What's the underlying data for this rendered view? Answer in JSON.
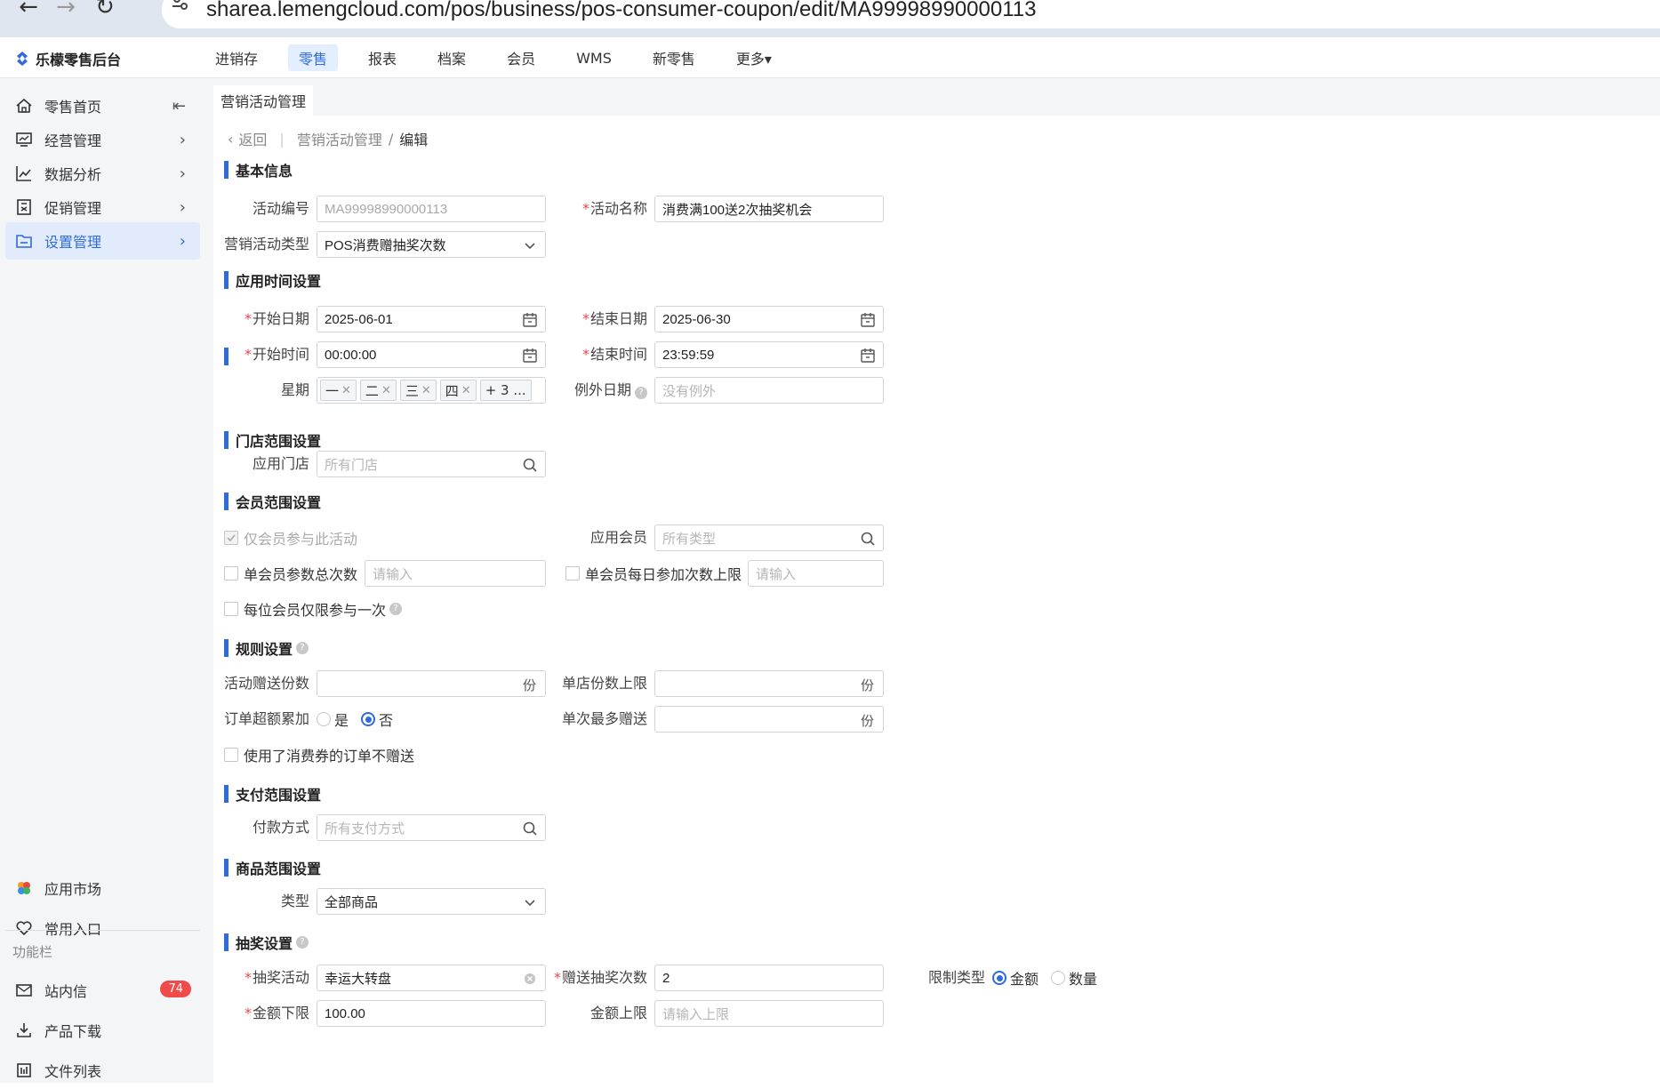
{
  "browser": {
    "url": "sharea.lemengcloud.com/pos/business/pos-consumer-coupon/edit/MA99998990000113"
  },
  "app": {
    "title": "乐檬零售后台"
  },
  "topmenu": [
    {
      "label": "进销存",
      "active": false
    },
    {
      "label": "零售",
      "active": true
    },
    {
      "label": "报表",
      "active": false
    },
    {
      "label": "档案",
      "active": false
    },
    {
      "label": "会员",
      "active": false
    },
    {
      "label": "WMS",
      "active": false
    },
    {
      "label": "新零售",
      "active": false
    },
    {
      "label": "更多▾",
      "active": false
    }
  ],
  "sidebar": {
    "items": [
      {
        "label": "零售首页",
        "icon": "home-icon"
      },
      {
        "label": "经营管理",
        "icon": "monitor-chart-icon"
      },
      {
        "label": "数据分析",
        "icon": "line-chart-icon"
      },
      {
        "label": "促销管理",
        "icon": "promotion-icon"
      },
      {
        "label": "设置管理",
        "icon": "folder-icon"
      }
    ],
    "bottom": [
      {
        "label": "应用市场",
        "icon": "app-market-icon"
      },
      {
        "label": "常用入口",
        "icon": "heart-icon"
      }
    ],
    "caption": "功能栏",
    "tools": [
      {
        "label": "站内信",
        "icon": "mail-icon",
        "badge": "74"
      },
      {
        "label": "产品下载",
        "icon": "download-icon"
      },
      {
        "label": "文件列表",
        "icon": "file-list-icon"
      }
    ]
  },
  "tab": {
    "label": "营销活动管理"
  },
  "breadcrumb": {
    "back": "返回",
    "parent": "营销活动管理",
    "sep": "/",
    "current": "编辑"
  },
  "sections": {
    "basic": "基本信息",
    "time": "应用时间设置",
    "store": "门店范围设置",
    "member": "会员范围设置",
    "rule": "规则设置",
    "pay": "支付范围设置",
    "goods": "商品范围设置",
    "lottery": "抽奖设置"
  },
  "form": {
    "code_label": "活动编号",
    "code_value": "MA99998990000113",
    "name_label": "活动名称",
    "name_value": "消费满100送2次抽奖机会",
    "type_label": "营销活动类型",
    "type_value": "POS消费赠抽奖次数",
    "start_date_label": "开始日期",
    "start_date": "2025-06-01",
    "end_date_label": "结束日期",
    "end_date": "2025-06-30",
    "start_time_label": "开始时间",
    "start_time": "00:00:00",
    "end_time_label": "结束时间",
    "end_time": "23:59:59",
    "week_label": "星期",
    "week_tags": [
      "一",
      "二",
      "三",
      "四"
    ],
    "week_more": "+ 3 ...",
    "except_label": "例外日期",
    "except_placeholder": "没有例外",
    "store_label": "应用门店",
    "store_placeholder": "所有门店",
    "member_only": "仅会员参与此活动",
    "member_label": "应用会员",
    "member_placeholder": "所有类型",
    "member_total": "单会员参数总次数",
    "member_total_placeholder": "请输入",
    "member_daily": "单会员每日参加次数上限",
    "member_daily_placeholder": "请输入",
    "member_once": "每位会员仅限参与一次",
    "gift_count_label": "活动赠送份数",
    "unit": "份",
    "store_limit_label": "单店份数上限",
    "overflow_label": "订单超额累加",
    "yes": "是",
    "no": "否",
    "max_each_label": "单次最多赠送",
    "coupon_used": "使用了消费券的订单不赠送",
    "pay_label": "付款方式",
    "pay_placeholder": "所有支付方式",
    "goods_type_label": "类型",
    "goods_type_value": "全部商品",
    "lottery_label": "抽奖活动",
    "lottery_value": "幸运大转盘",
    "lottery_times_label": "赠送抽奖次数",
    "lottery_times": "2",
    "limit_type_label": "限制类型",
    "limit_amount": "金额",
    "limit_quantity": "数量",
    "amount_min_label": "金额下限",
    "amount_min": "100.00",
    "amount_max_label": "金额上限",
    "amount_max_placeholder": "请输入上限"
  },
  "colors": {
    "accent": "#2f6bd9",
    "required": "#e5484d",
    "badge": "#f04b4b"
  }
}
